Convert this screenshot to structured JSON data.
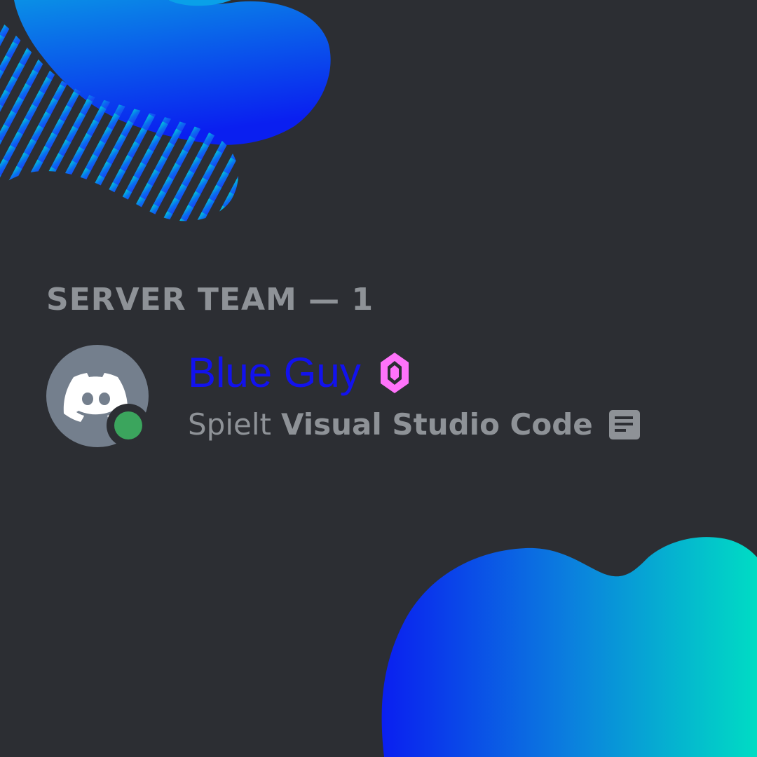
{
  "colors": {
    "background": "#2c2e33",
    "muted_text": "#8e9297",
    "member_name": "#1212ee",
    "booster": "#ff73fa",
    "online": "#3ba55d",
    "avatar_bg": "#747f8d",
    "blob_blue": "#0a1ff0",
    "blob_teal": "#00d8c6"
  },
  "member_list": {
    "section_header": "SERVER TEAM — 1",
    "members": [
      {
        "name": "Blue Guy",
        "avatar_icon": "discord-logo-icon",
        "status": "online",
        "badge_icon": "nitro-booster-icon",
        "activity_verb": "Spielt",
        "activity_name": "Visual Studio Code",
        "activity_icon": "rich-presence-icon"
      }
    ]
  }
}
